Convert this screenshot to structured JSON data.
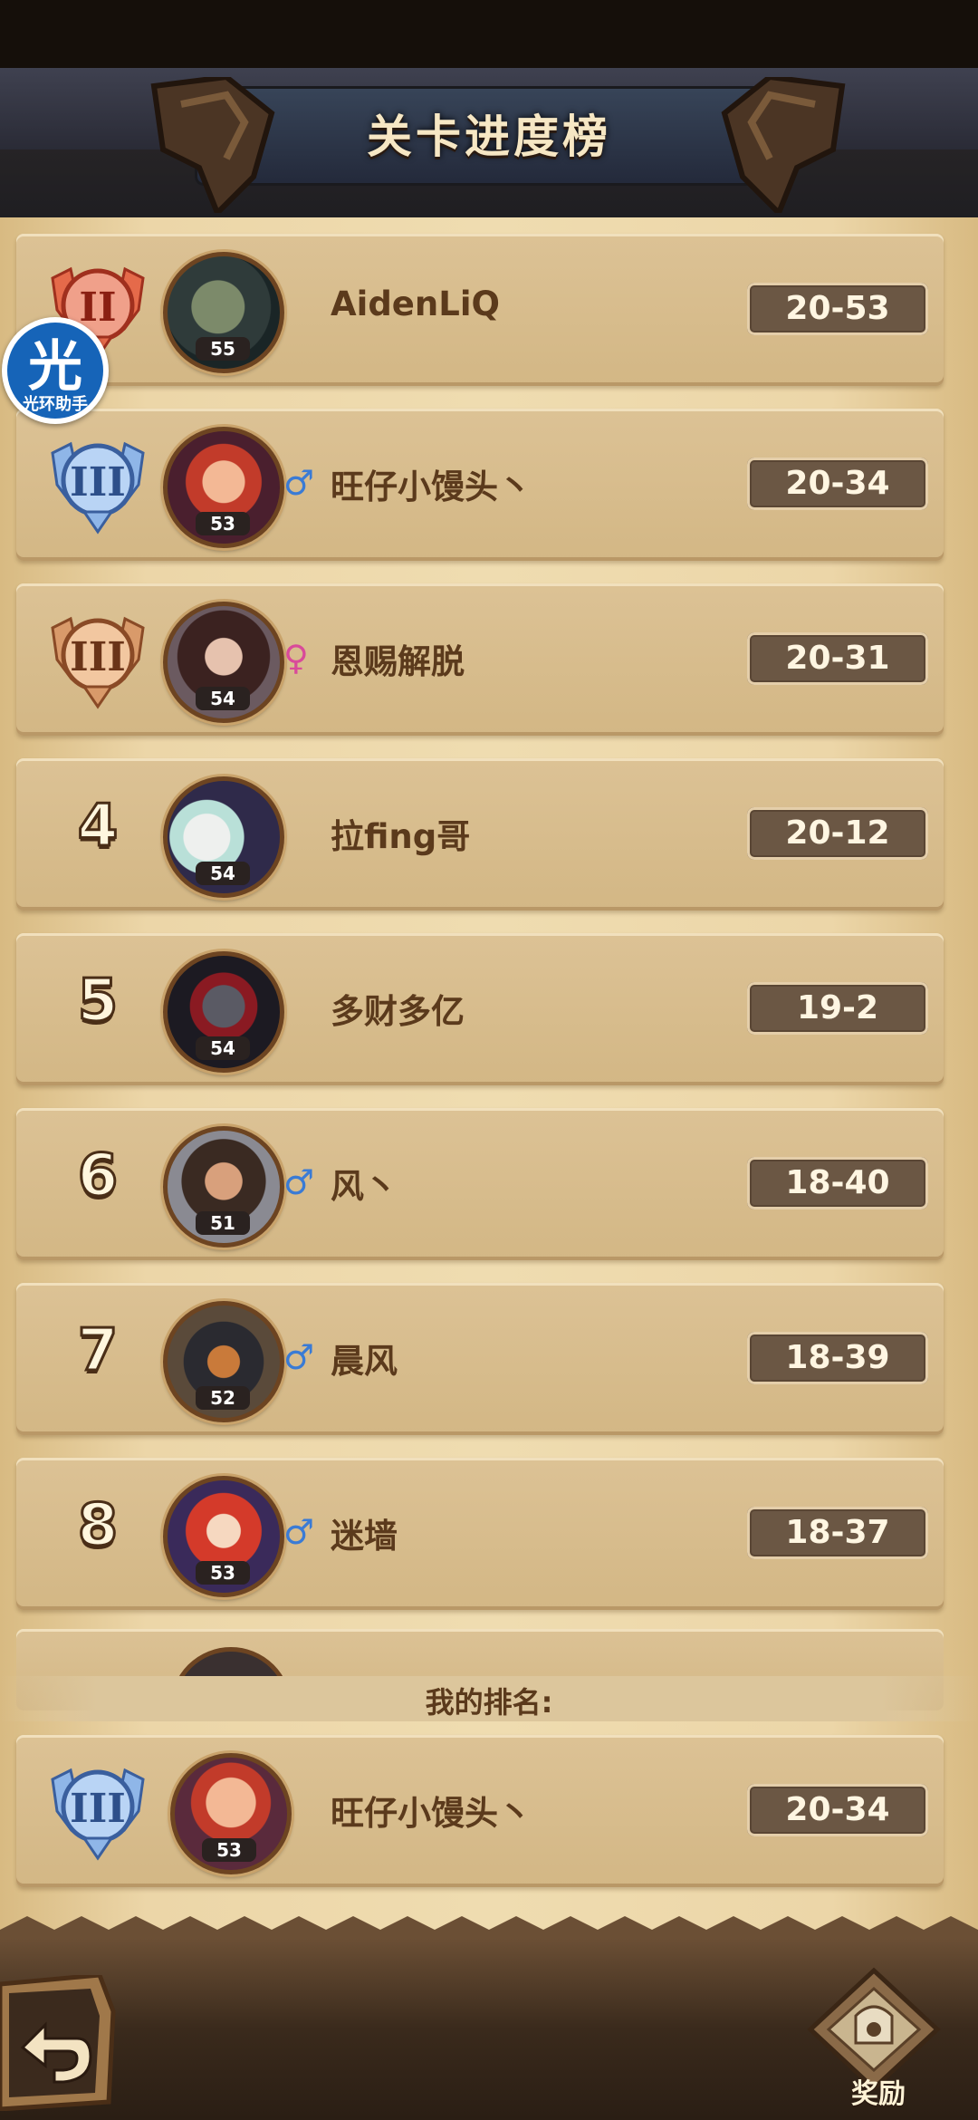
{
  "title": "关卡进度榜",
  "helper": {
    "glyph": "光",
    "label": "光环助手"
  },
  "rows": [
    {
      "rank": "",
      "badge": "medal-2-gold",
      "level": "55",
      "gender": "",
      "name": "AidenLiQ",
      "score": "20-53"
    },
    {
      "rank": "",
      "badge": "medal-3-silver",
      "level": "53",
      "gender": "♂",
      "name": "旺仔小馒头丶",
      "score": "20-34"
    },
    {
      "rank": "",
      "badge": "medal-3-bronze",
      "level": "54",
      "gender": "♀",
      "name": "恩赐解脱",
      "score": "20-31"
    },
    {
      "rank": "4",
      "badge": "",
      "level": "54",
      "gender": "",
      "name": "拉fing哥",
      "score": "20-12"
    },
    {
      "rank": "5",
      "badge": "",
      "level": "54",
      "gender": "",
      "name": "多财多亿",
      "score": "19-2"
    },
    {
      "rank": "6",
      "badge": "",
      "level": "51",
      "gender": "♂",
      "name": "风丶",
      "score": "18-40"
    },
    {
      "rank": "7",
      "badge": "",
      "level": "52",
      "gender": "♂",
      "name": "晨风",
      "score": "18-39"
    },
    {
      "rank": "8",
      "badge": "",
      "level": "53",
      "gender": "♂",
      "name": "迷墙",
      "score": "18-37"
    }
  ],
  "my_rank_label": "我的排名:",
  "my_row": {
    "badge": "medal-3-silver",
    "level": "53",
    "name": "旺仔小馒头丶",
    "score": "20-34"
  },
  "reward_label": "奖励",
  "colors": {
    "male": "#3a7bd5",
    "female": "#d94a9a"
  }
}
